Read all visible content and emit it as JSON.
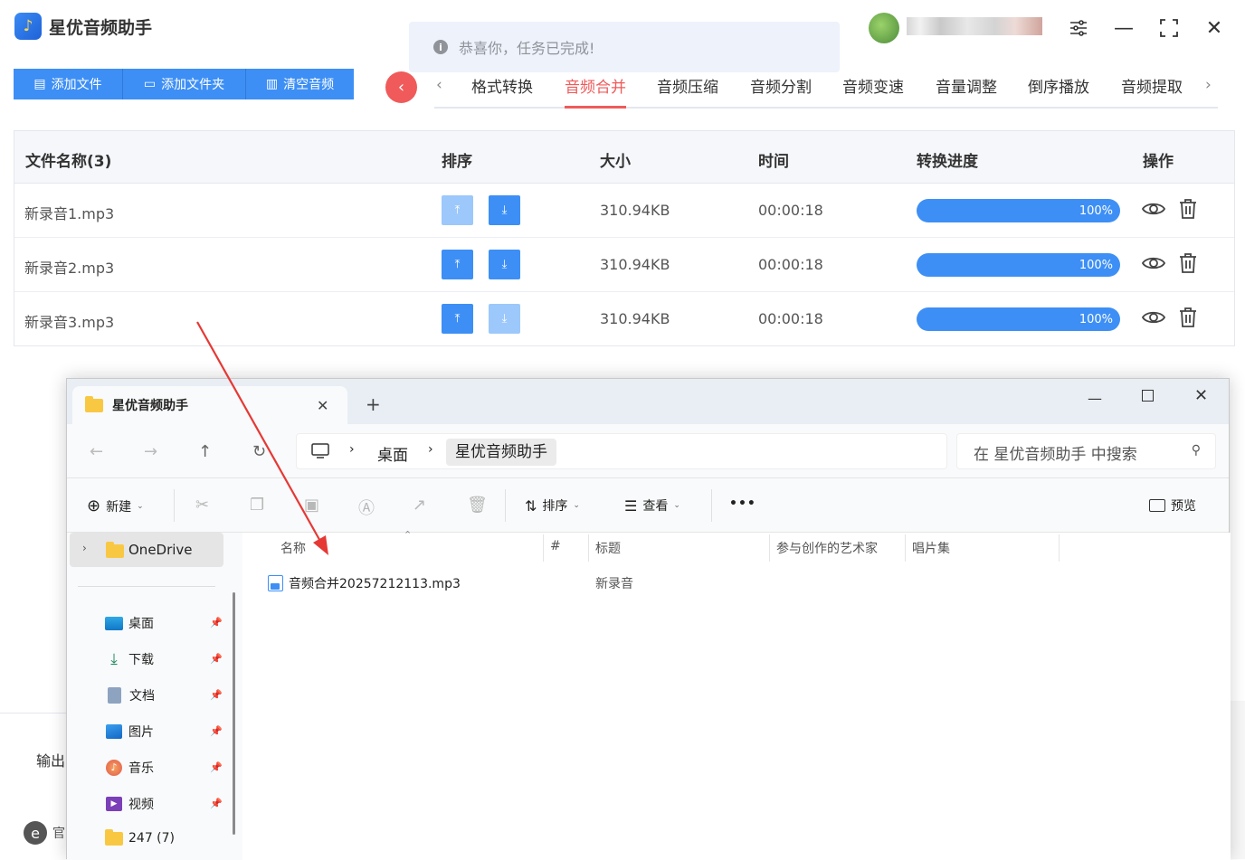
{
  "app": {
    "title": "星优音频助手",
    "toast": "恭喜你，任务已完成!",
    "buttons": {
      "add_file": "添加文件",
      "add_folder": "添加文件夹",
      "clear": "清空音频"
    },
    "tabs": [
      "格式转换",
      "音频合并",
      "音频压缩",
      "音频分割",
      "音频变速",
      "音量调整",
      "倒序播放",
      "音频提取"
    ],
    "active_tab": "音频合并",
    "table": {
      "headers": [
        "文件名称(3)",
        "排序",
        "大小",
        "时间",
        "转换进度",
        "操作"
      ],
      "rows": [
        {
          "name": "新录音1.mp3",
          "size": "310.94KB",
          "time": "00:00:18",
          "progress": "100%",
          "up_enabled": false,
          "down_enabled": true
        },
        {
          "name": "新录音2.mp3",
          "size": "310.94KB",
          "time": "00:00:18",
          "progress": "100%",
          "up_enabled": true,
          "down_enabled": true
        },
        {
          "name": "新录音3.mp3",
          "size": "310.94KB",
          "time": "00:00:18",
          "progress": "100%",
          "up_enabled": true,
          "down_enabled": false
        }
      ]
    },
    "output_label": "输出",
    "footer_label": "官"
  },
  "explorer": {
    "tab_title": "星优音频助手",
    "breadcrumb": [
      "桌面",
      "星优音频助手"
    ],
    "search_placeholder": "在 星优音频助手 中搜索",
    "toolbar": {
      "new": "新建",
      "sort": "排序",
      "view": "查看",
      "more": "•••",
      "preview": "预览"
    },
    "sidebar": {
      "onedrive": "OneDrive",
      "quick": [
        {
          "label": "桌面",
          "icon": "desktop-icon"
        },
        {
          "label": "下载",
          "icon": "download-icon"
        },
        {
          "label": "文档",
          "icon": "document-icon"
        },
        {
          "label": "图片",
          "icon": "picture-icon"
        },
        {
          "label": "音乐",
          "icon": "music-icon"
        },
        {
          "label": "视频",
          "icon": "video-icon"
        }
      ],
      "folder": "247 (7)"
    },
    "columns": [
      "名称",
      "#",
      "标题",
      "参与创作的艺术家",
      "唱片集"
    ],
    "files": [
      {
        "name": "音频合并20257212113.mp3",
        "title": "新录音"
      }
    ]
  },
  "colors": {
    "primary": "#3d8ff5",
    "accent": "#f05a5a",
    "arrow": "#e53935"
  }
}
